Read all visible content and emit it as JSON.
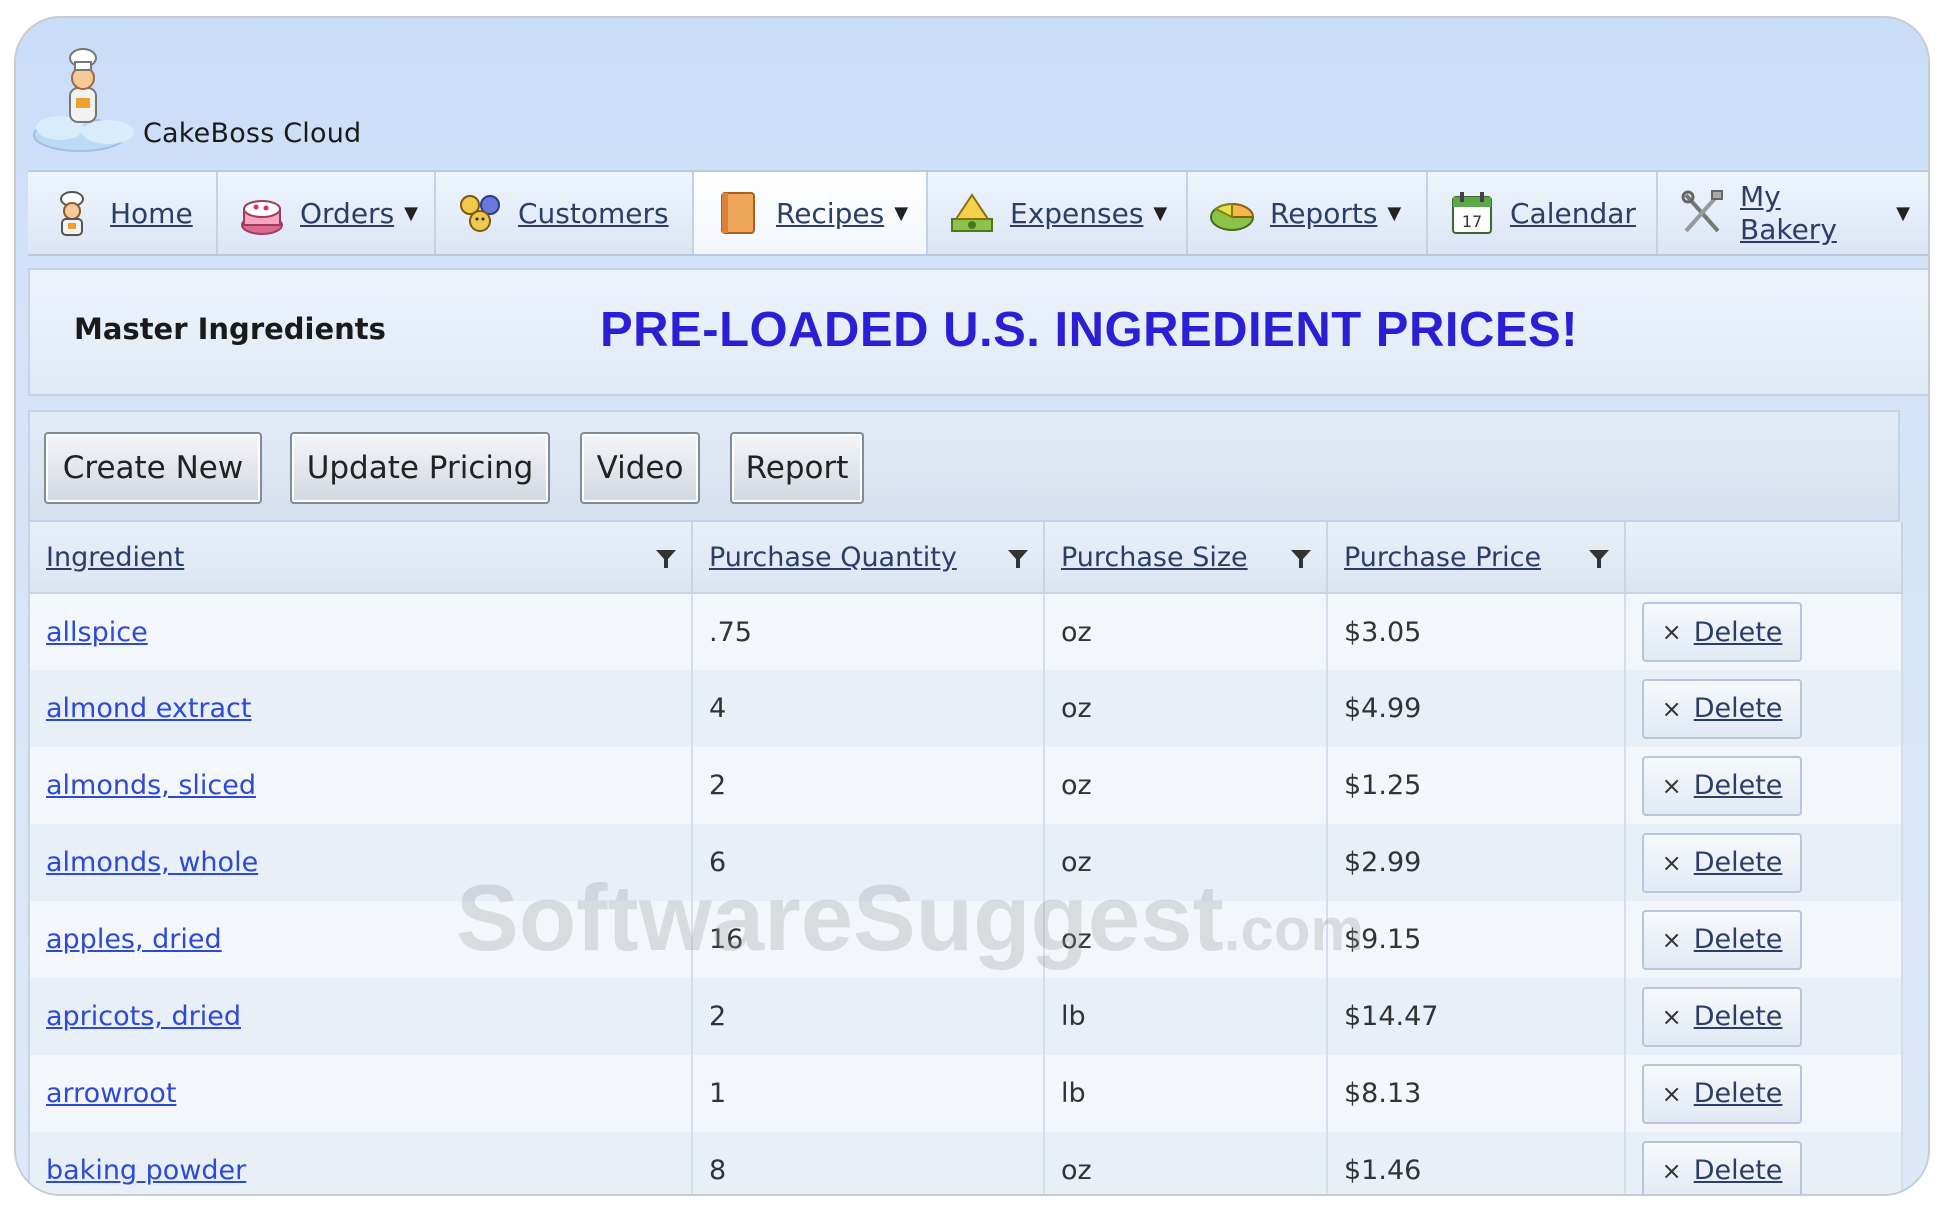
{
  "app": {
    "title": "CakeBoss Cloud"
  },
  "nav": {
    "items": [
      {
        "label": "Home",
        "icon": "chef-icon",
        "has_menu": false
      },
      {
        "label": "Orders",
        "icon": "cake-icon",
        "has_menu": true
      },
      {
        "label": "Customers",
        "icon": "customers-icon",
        "has_menu": false
      },
      {
        "label": "Recipes",
        "icon": "recipe-book-icon",
        "has_menu": true
      },
      {
        "label": "Expenses",
        "icon": "money-icon",
        "has_menu": true
      },
      {
        "label": "Reports",
        "icon": "pie-chart-icon",
        "has_menu": true
      },
      {
        "label": "Calendar",
        "icon": "calendar-icon",
        "has_menu": false
      },
      {
        "label": "My Bakery",
        "icon": "tools-icon",
        "has_menu": true
      }
    ],
    "active": "Recipes",
    "caret": "▼",
    "calendar_day": "17"
  },
  "panel": {
    "title": "Master Ingredients",
    "promo": "PRE-LOADED U.S. INGREDIENT PRICES!"
  },
  "toolbar": {
    "create_new": "Create New",
    "update_pricing": "Update Pricing",
    "video": "Video",
    "report": "Report"
  },
  "table": {
    "columns": [
      "Ingredient",
      "Purchase Quantity",
      "Purchase Size",
      "Purchase Price"
    ],
    "delete_label": "Delete",
    "delete_glyph": "×",
    "rows": [
      {
        "ingredient": "allspice",
        "quantity": ".75",
        "size": "oz",
        "price": "$3.05"
      },
      {
        "ingredient": "almond extract",
        "quantity": "4",
        "size": "oz",
        "price": "$4.99"
      },
      {
        "ingredient": "almonds, sliced",
        "quantity": "2",
        "size": "oz",
        "price": "$1.25"
      },
      {
        "ingredient": "almonds, whole",
        "quantity": "6",
        "size": "oz",
        "price": "$2.99"
      },
      {
        "ingredient": "apples, dried",
        "quantity": "16",
        "size": "oz",
        "price": "$9.15"
      },
      {
        "ingredient": "apricots, dried",
        "quantity": "2",
        "size": "lb",
        "price": "$14.47"
      },
      {
        "ingredient": "arrowroot",
        "quantity": "1",
        "size": "lb",
        "price": "$8.13"
      },
      {
        "ingredient": "baking powder",
        "quantity": "8",
        "size": "oz",
        "price": "$1.46"
      }
    ]
  },
  "watermark": {
    "main": "SoftwareSuggest",
    "suffix": ".com"
  }
}
